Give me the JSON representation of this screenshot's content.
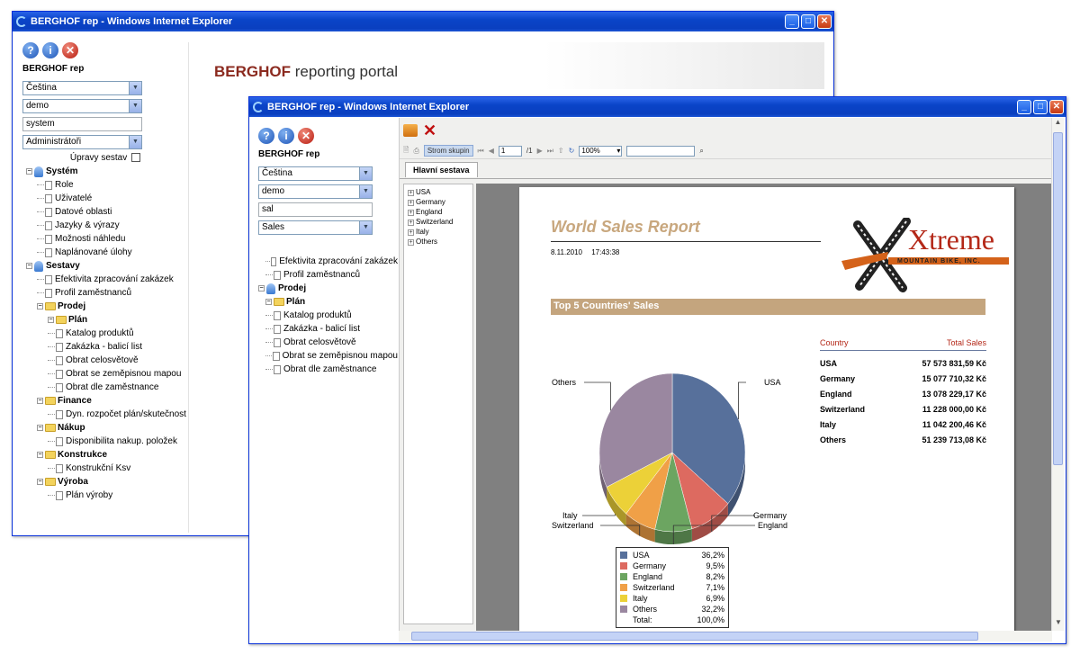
{
  "back_window": {
    "title": "BERGHOF rep - Windows Internet Explorer",
    "app_title": "BERGHOF rep",
    "language": "Čeština",
    "database": "demo",
    "user": "system",
    "role": "Administrátoři",
    "edit_label": "Úpravy sestav",
    "banner_brand": "BERGHOF",
    "banner_rest": " reporting portal",
    "tree": [
      {
        "label": "Systém",
        "bold": true,
        "level": 0,
        "kind": "globe"
      },
      {
        "label": "Role",
        "level": 1,
        "kind": "file"
      },
      {
        "label": "Uživatelé",
        "level": 1,
        "kind": "file"
      },
      {
        "label": "Datové oblasti",
        "level": 1,
        "kind": "file"
      },
      {
        "label": "Jazyky & výrazy",
        "level": 1,
        "kind": "file"
      },
      {
        "label": "Možnosti náhledu",
        "level": 1,
        "kind": "file"
      },
      {
        "label": "Naplánované úlohy",
        "level": 1,
        "kind": "file"
      },
      {
        "label": "Sestavy",
        "bold": true,
        "level": 0,
        "kind": "globe"
      },
      {
        "label": "Efektivita zpracování zakázek",
        "level": 1,
        "kind": "file"
      },
      {
        "label": "Profil zaměstnanců",
        "level": 1,
        "kind": "file"
      },
      {
        "label": "Prodej",
        "bold": true,
        "level": 1,
        "kind": "folder"
      },
      {
        "label": "Plán",
        "bold": true,
        "level": 2,
        "kind": "folder"
      },
      {
        "label": "Katalog produktů",
        "level": 2,
        "kind": "file"
      },
      {
        "label": "Zakázka - balicí list",
        "level": 2,
        "kind": "file"
      },
      {
        "label": "Obrat celosvětově",
        "level": 2,
        "kind": "file"
      },
      {
        "label": "Obrat se zeměpisnou mapou",
        "level": 2,
        "kind": "file"
      },
      {
        "label": "Obrat dle zaměstnance",
        "level": 2,
        "kind": "file"
      },
      {
        "label": "Finance",
        "bold": true,
        "level": 1,
        "kind": "folder"
      },
      {
        "label": "Dyn. rozpočet plán/skutečnost",
        "level": 2,
        "kind": "file"
      },
      {
        "label": "Nákup",
        "bold": true,
        "level": 1,
        "kind": "folder"
      },
      {
        "label": "Disponibilita nakup. položek",
        "level": 2,
        "kind": "file"
      },
      {
        "label": "Konstrukce",
        "bold": true,
        "level": 1,
        "kind": "folder"
      },
      {
        "label": "Konstrukční Ksv",
        "level": 2,
        "kind": "file"
      },
      {
        "label": "Výroba",
        "bold": true,
        "level": 1,
        "kind": "folder"
      },
      {
        "label": "Plán výroby",
        "level": 2,
        "kind": "file"
      }
    ]
  },
  "front_window": {
    "title": "BERGHOF rep - Windows Internet Explorer",
    "app_title": "BERGHOF rep",
    "language": "Čeština",
    "database": "demo",
    "user": "sal",
    "role": "Sales",
    "tree": [
      {
        "label": "Efektivita zpracování zakázek",
        "level": 1,
        "kind": "file"
      },
      {
        "label": "Profil zaměstnanců",
        "level": 1,
        "kind": "file"
      },
      {
        "label": "Prodej",
        "bold": true,
        "level": 0,
        "kind": "globe"
      },
      {
        "label": "Plán",
        "bold": true,
        "level": 1,
        "kind": "folder"
      },
      {
        "label": "Katalog produktů",
        "level": 1,
        "kind": "file"
      },
      {
        "label": "Zakázka - balicí list",
        "level": 1,
        "kind": "file"
      },
      {
        "label": "Obrat celosvětově",
        "level": 1,
        "kind": "file"
      },
      {
        "label": "Obrat se zeměpisnou mapou",
        "level": 1,
        "kind": "file"
      },
      {
        "label": "Obrat dle zaměstnance",
        "level": 1,
        "kind": "file"
      }
    ],
    "toolbar": {
      "group_tree": "Strom skupin",
      "page_current": "1",
      "page_total": "/1",
      "zoom": "100%",
      "search_value": ""
    },
    "tab_label": "Hlavní sestava",
    "group_tree_items": [
      "USA",
      "Germany",
      "England",
      "Switzerland",
      "Italy",
      "Others"
    ],
    "report": {
      "title": "World Sales Report",
      "date": "8.11.2010",
      "time": "17:43:38",
      "logo_main": "Xtreme",
      "logo_sub": "MOUNTAIN BIKE, INC.",
      "section_title": "Top 5 Countries' Sales",
      "table_headers": [
        "Country",
        "Total Sales"
      ],
      "table_rows": [
        {
          "country": "USA",
          "sales": "57 573 831,59 Kč"
        },
        {
          "country": "Germany",
          "sales": "15 077 710,32 Kč"
        },
        {
          "country": "England",
          "sales": "13 078 229,17 Kč"
        },
        {
          "country": "Switzerland",
          "sales": "11 228 000,00 Kč"
        },
        {
          "country": "Italy",
          "sales": "11 042 200,46 Kč"
        },
        {
          "country": "Others",
          "sales": "51 239 713,08 Kč"
        }
      ],
      "total_label": "Total:",
      "total_value": "100,0%"
    }
  },
  "chart_data": {
    "type": "pie",
    "categories": [
      "USA",
      "Germany",
      "England",
      "Switzerland",
      "Italy",
      "Others"
    ],
    "values": [
      36.2,
      9.5,
      8.2,
      7.1,
      6.9,
      32.2
    ],
    "labels": [
      "36,2%",
      "9,5%",
      "8,2%",
      "7,1%",
      "6,9%",
      "32,2%"
    ],
    "colors": [
      "#57709b",
      "#dd6a60",
      "#6ca561",
      "#f0a047",
      "#ecd138",
      "#9a87a0"
    ],
    "legend_placement": "bottom"
  }
}
